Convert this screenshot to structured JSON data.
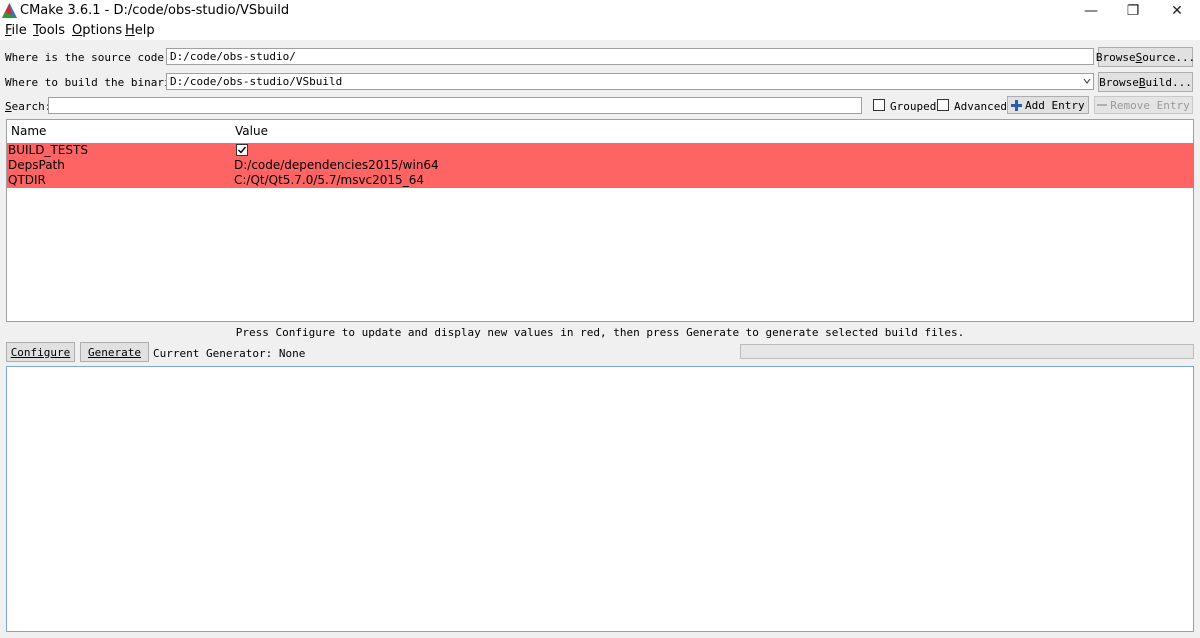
{
  "window": {
    "title": "CMake 3.6.1 - D:/code/obs-studio/VSbuild",
    "minimize_glyph": "—",
    "restore_glyph": "❐",
    "close_glyph": "✕"
  },
  "menu": [
    {
      "mnemonic": "F",
      "rest": "ile"
    },
    {
      "mnemonic": "T",
      "rest": "ools"
    },
    {
      "mnemonic": "O",
      "rest": "ptions"
    },
    {
      "mnemonic": "H",
      "rest": "elp"
    }
  ],
  "source": {
    "label": "Where is the source code:",
    "value": "D:/code/obs-studio/",
    "browse_label_pre": "Browse ",
    "browse_mnemonic": "S",
    "browse_label_post": "ource..."
  },
  "build": {
    "label": "Where to build the binaries:",
    "value": "D:/code/obs-studio/VSbuild",
    "browse_label_pre": "Browse ",
    "browse_mnemonic": "B",
    "browse_label_post": "uild..."
  },
  "search": {
    "label_mnemonic": "S",
    "label_rest": "earch:",
    "value": ""
  },
  "options": {
    "grouped_label": "Grouped",
    "advanced_label": "Advanced",
    "add_entry_label": "Add Entry",
    "remove_entry_label": "Remove Entry"
  },
  "table": {
    "columns": [
      "Name",
      "Value"
    ],
    "rows": [
      {
        "name": "BUILD_TESTS",
        "value": "",
        "checked": true
      },
      {
        "name": "DepsPath",
        "value": "D:/code/dependencies2015/win64"
      },
      {
        "name": "QTDIR",
        "value": "C:/Qt/Qt5.7.0/5.7/msvc2015_64"
      }
    ],
    "changed_row_color": "#ff6464"
  },
  "hint": "Press Configure to update and display new values in red, then press Generate to generate selected build files.",
  "actions": {
    "configure_label": "Configure",
    "generate_label": "Generate",
    "generator_text": "Current Generator: None"
  },
  "progress": 0,
  "output": ""
}
